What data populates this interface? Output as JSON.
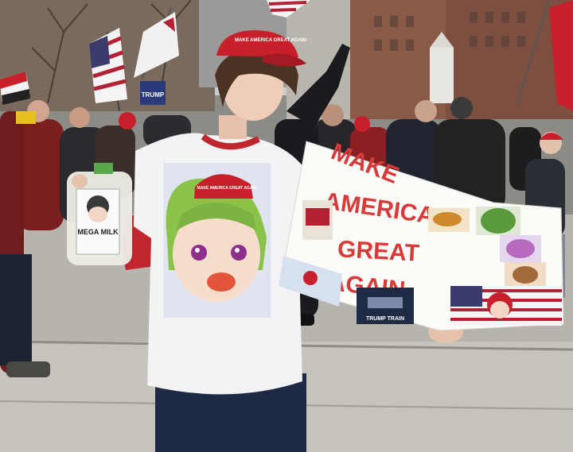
{
  "scene": {
    "sign": {
      "lines": [
        "MAKE",
        "AMERICA",
        "GREAT",
        "AGAIN"
      ],
      "sticker_caption": "TRUMP TRAIN"
    },
    "cap_text": "MAKE AMERICA GREAT AGAIN",
    "shirt_cap_text": "MAKE AMERICA GREAT AGAIN",
    "jug_label": "MEGA MILK",
    "background_sign_text": "TRUMP",
    "colors": {
      "cap_red": "#c8202a",
      "sign_letters": "#d83a3a",
      "shirt": "#f3f3f5",
      "flag_red": "#b22234",
      "flag_blue": "#3c3b6e"
    }
  }
}
